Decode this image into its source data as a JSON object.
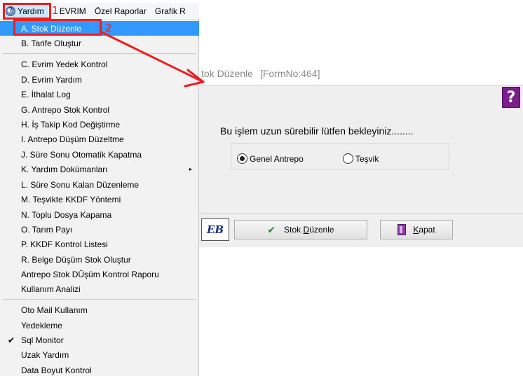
{
  "menubar": {
    "items": [
      "Yardım",
      "EVRIM",
      "Özel Raporlar",
      "Grafik R"
    ]
  },
  "annotations": {
    "badge1": "1",
    "badge2": "2",
    "color": "#ee1c1c"
  },
  "menu": {
    "items": [
      "A.  Stok Düzenle",
      "B.  Tarife Oluştur",
      "C.  Evrim Yedek Kontrol",
      "D.  Evrim Yardım",
      "E.  İthalat Log",
      "G.  Antrepo Stok Kontrol",
      "H.  İş Takip Kod Değiştirme",
      "I.   Antrepo Düşüm Düzeltme",
      "J.  Süre Sonu Otomatik Kapatma",
      "K.  Yardım Dokümanları",
      "L. Süre Sonu Kalan Düzenleme",
      "M. Teşvikte KKDF Yöntemi",
      "N. Toplu Dosya Kapama",
      "O. Tarım Payı",
      "P. KKDF Kontrol Listesi",
      "R. Belge Düşüm Stok Oluştur",
      "Antrepo Stok DÜşüm Kontrol Raporu",
      "Kullanım Analizi",
      "Oto Mail Kullanım",
      "Yedekleme",
      "Sql Monitor",
      "Uzak Yardım",
      "Data Boyut Kontrol"
    ],
    "checked_index": 20,
    "submenu_arrow": "▸",
    "check_glyph": "✔"
  },
  "dialog": {
    "title": "tok Düzenle",
    "form_no": "[FormNo:464]",
    "help_glyph": "?",
    "message": "Bu işlem uzun sürebilir lütfen bekleyiniz........",
    "radio_1": "Genel Antrepo",
    "radio_2": "Teşvik",
    "eb_label": "EB",
    "stok_btn_a": "Stok ",
    "stok_btn_u": "D",
    "stok_btn_b": "üzenle",
    "kapat_u": "K",
    "kapat_b": "apat"
  }
}
